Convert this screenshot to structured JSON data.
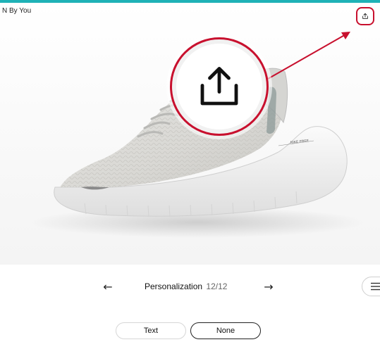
{
  "header": {
    "brand_partial": "N By You",
    "accent_color": "#1fb2b7"
  },
  "toolbar": {
    "share_icon": "share-icon",
    "highlight_color": "#c8102e"
  },
  "navigator": {
    "prev_label": "←",
    "step_name": "Personalization",
    "step_count": "12/12",
    "next_label": "→",
    "menu_icon": "hamburger-menu-icon"
  },
  "options": [
    {
      "label": "Text",
      "selected": false
    },
    {
      "label": "None",
      "selected": true
    }
  ]
}
